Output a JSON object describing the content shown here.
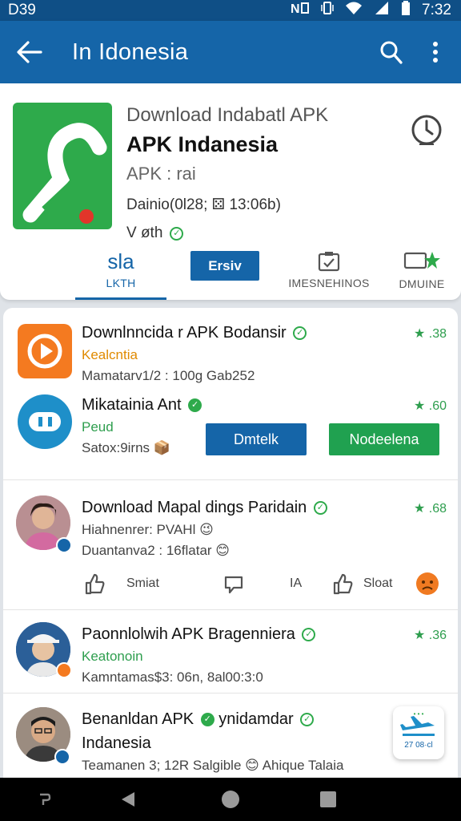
{
  "status_bar": {
    "time_left": "D39",
    "clock": "7:32"
  },
  "app_bar": {
    "title": "In Idonesia"
  },
  "header": {
    "subtitle": "Download Indabatl APK",
    "title": "APK Indanesia",
    "type_line": "APK : rai",
    "meta_line": "Dainio(0l28; ⚄ 13:06b)",
    "version_line": "V øth",
    "tabs": [
      {
        "id": "tab-1",
        "label": "LKTH",
        "glyph": "sla"
      },
      {
        "id": "tab-2",
        "label": "Ersiv"
      },
      {
        "id": "tab-3",
        "label": "IMESNEHINOS"
      },
      {
        "id": "tab-4",
        "label": "DMUINE"
      }
    ]
  },
  "list": {
    "items": [
      {
        "title": "Downlnncida r APK Bodansir",
        "sub": "Kealcntia",
        "meta": "Mamatarv1/2 : 100g Gab252",
        "rating": "★ .38"
      },
      {
        "title": "Mikatainia Ant",
        "sub": "Peud",
        "meta": "Satox:9irns",
        "rating": "★ .60",
        "button_primary": "Dmtelk",
        "button_secondary": "Nodeelena"
      },
      {
        "title": "Download Mapal dings Paridain",
        "sub": "Hiahnenrer: PVAHl",
        "meta": "Duantanva2 : 16flatar",
        "rating": "★ .68",
        "actions": {
          "like_label": "Smiat",
          "count": "IA",
          "share_label": "Sloat"
        }
      },
      {
        "title": "Paonnlolwih APK Bragenniera",
        "sub": "Keatonoin",
        "meta": "Kamntamas$3: 06n, 8al00:3:0",
        "rating": "★ .36"
      },
      {
        "title": "Benanldan APK",
        "title_b": "ynidamdar",
        "title_line2": "Indanesia",
        "meta": "Teamanen 3; 12R Salgible",
        "meta_b": "Ahique Talaia",
        "float_badge": "27 08·cl"
      }
    ]
  },
  "colors": {
    "primary": "#1565a8",
    "status_bar": "#0f4f86",
    "green": "#2eaa4b",
    "orange": "#f47a20"
  }
}
